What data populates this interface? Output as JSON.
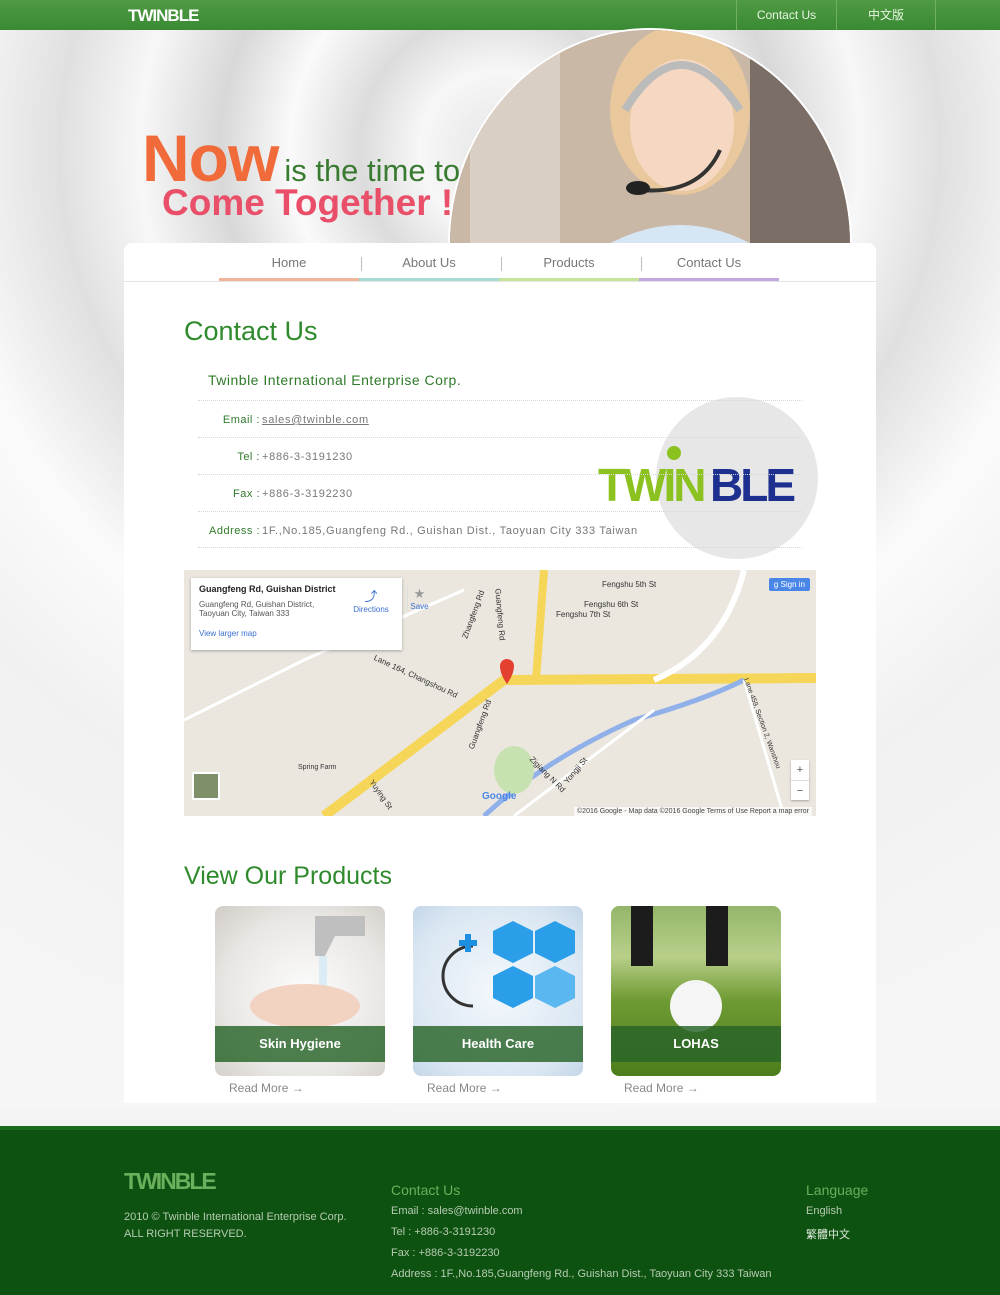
{
  "topbar": {
    "contact": "Contact Us",
    "lang": "中文版"
  },
  "hero": {
    "now": "Now",
    "rest": "is the time to",
    "come": "Come Together !"
  },
  "nav": {
    "items": [
      "Home",
      "About Us",
      "Products",
      "Contact Us"
    ]
  },
  "contact": {
    "title": "Contact Us",
    "company": "Twinble International Enterprise Corp.",
    "email_label": "Email :",
    "email": "sales@twinble.com",
    "tel_label": "Tel :",
    "tel": "+886-3-3191230",
    "fax_label": "Fax :",
    "fax": "+886-3-3192230",
    "address_label": "Address :",
    "address": "1F.,No.185,Guangfeng Rd., Guishan Dist., Taoyuan City 333 Taiwan"
  },
  "map": {
    "place": "Guangfeng Rd, Guishan District",
    "addr1": "Guangfeng Rd, Guishan District,",
    "addr2": "Taoyuan City, Taiwan 333",
    "directions": "Directions",
    "save": "Save",
    "larger": "View larger map",
    "signin": "Sign in",
    "labels": [
      "Fengshu 5th St",
      "Fengshu 6th St",
      "Fengshu 7th St",
      "Zhangfeng Rd",
      "Guangfeng Rd",
      "Lane 164, Changshou Rd",
      "Guangfeng Rd",
      "Zigiang N Rd",
      "Yongji St",
      "Yuying St",
      "Spring Farm",
      "Lane 459, Section 2, Wanshou"
    ],
    "footer": "©2016 Google - Map data ©2016 Google    Terms of Use    Report a map error",
    "google": "Google"
  },
  "products": {
    "title": "View Our Products",
    "items": [
      {
        "name": "Skin Hygiene",
        "more": "Read More →"
      },
      {
        "name": "Health Care",
        "more": "Read More →"
      },
      {
        "name": "LOHAS",
        "more": "Read More →"
      }
    ]
  },
  "footer": {
    "copyright": "2010 © Twinble International Enterprise Corp.",
    "rights": "ALL RIGHT RESERVED.",
    "contact_title": "Contact Us",
    "email": "Email : sales@twinble.com",
    "tel": "Tel : +886-3-3191230",
    "fax": "Fax : +886-3-3192230",
    "address": "Address : 1F.,No.185,Guangfeng Rd., Guishan Dist., Taoyuan City 333 Taiwan",
    "lang_title": "Language",
    "lang_en": "English",
    "lang_zh": "繁體中文"
  }
}
